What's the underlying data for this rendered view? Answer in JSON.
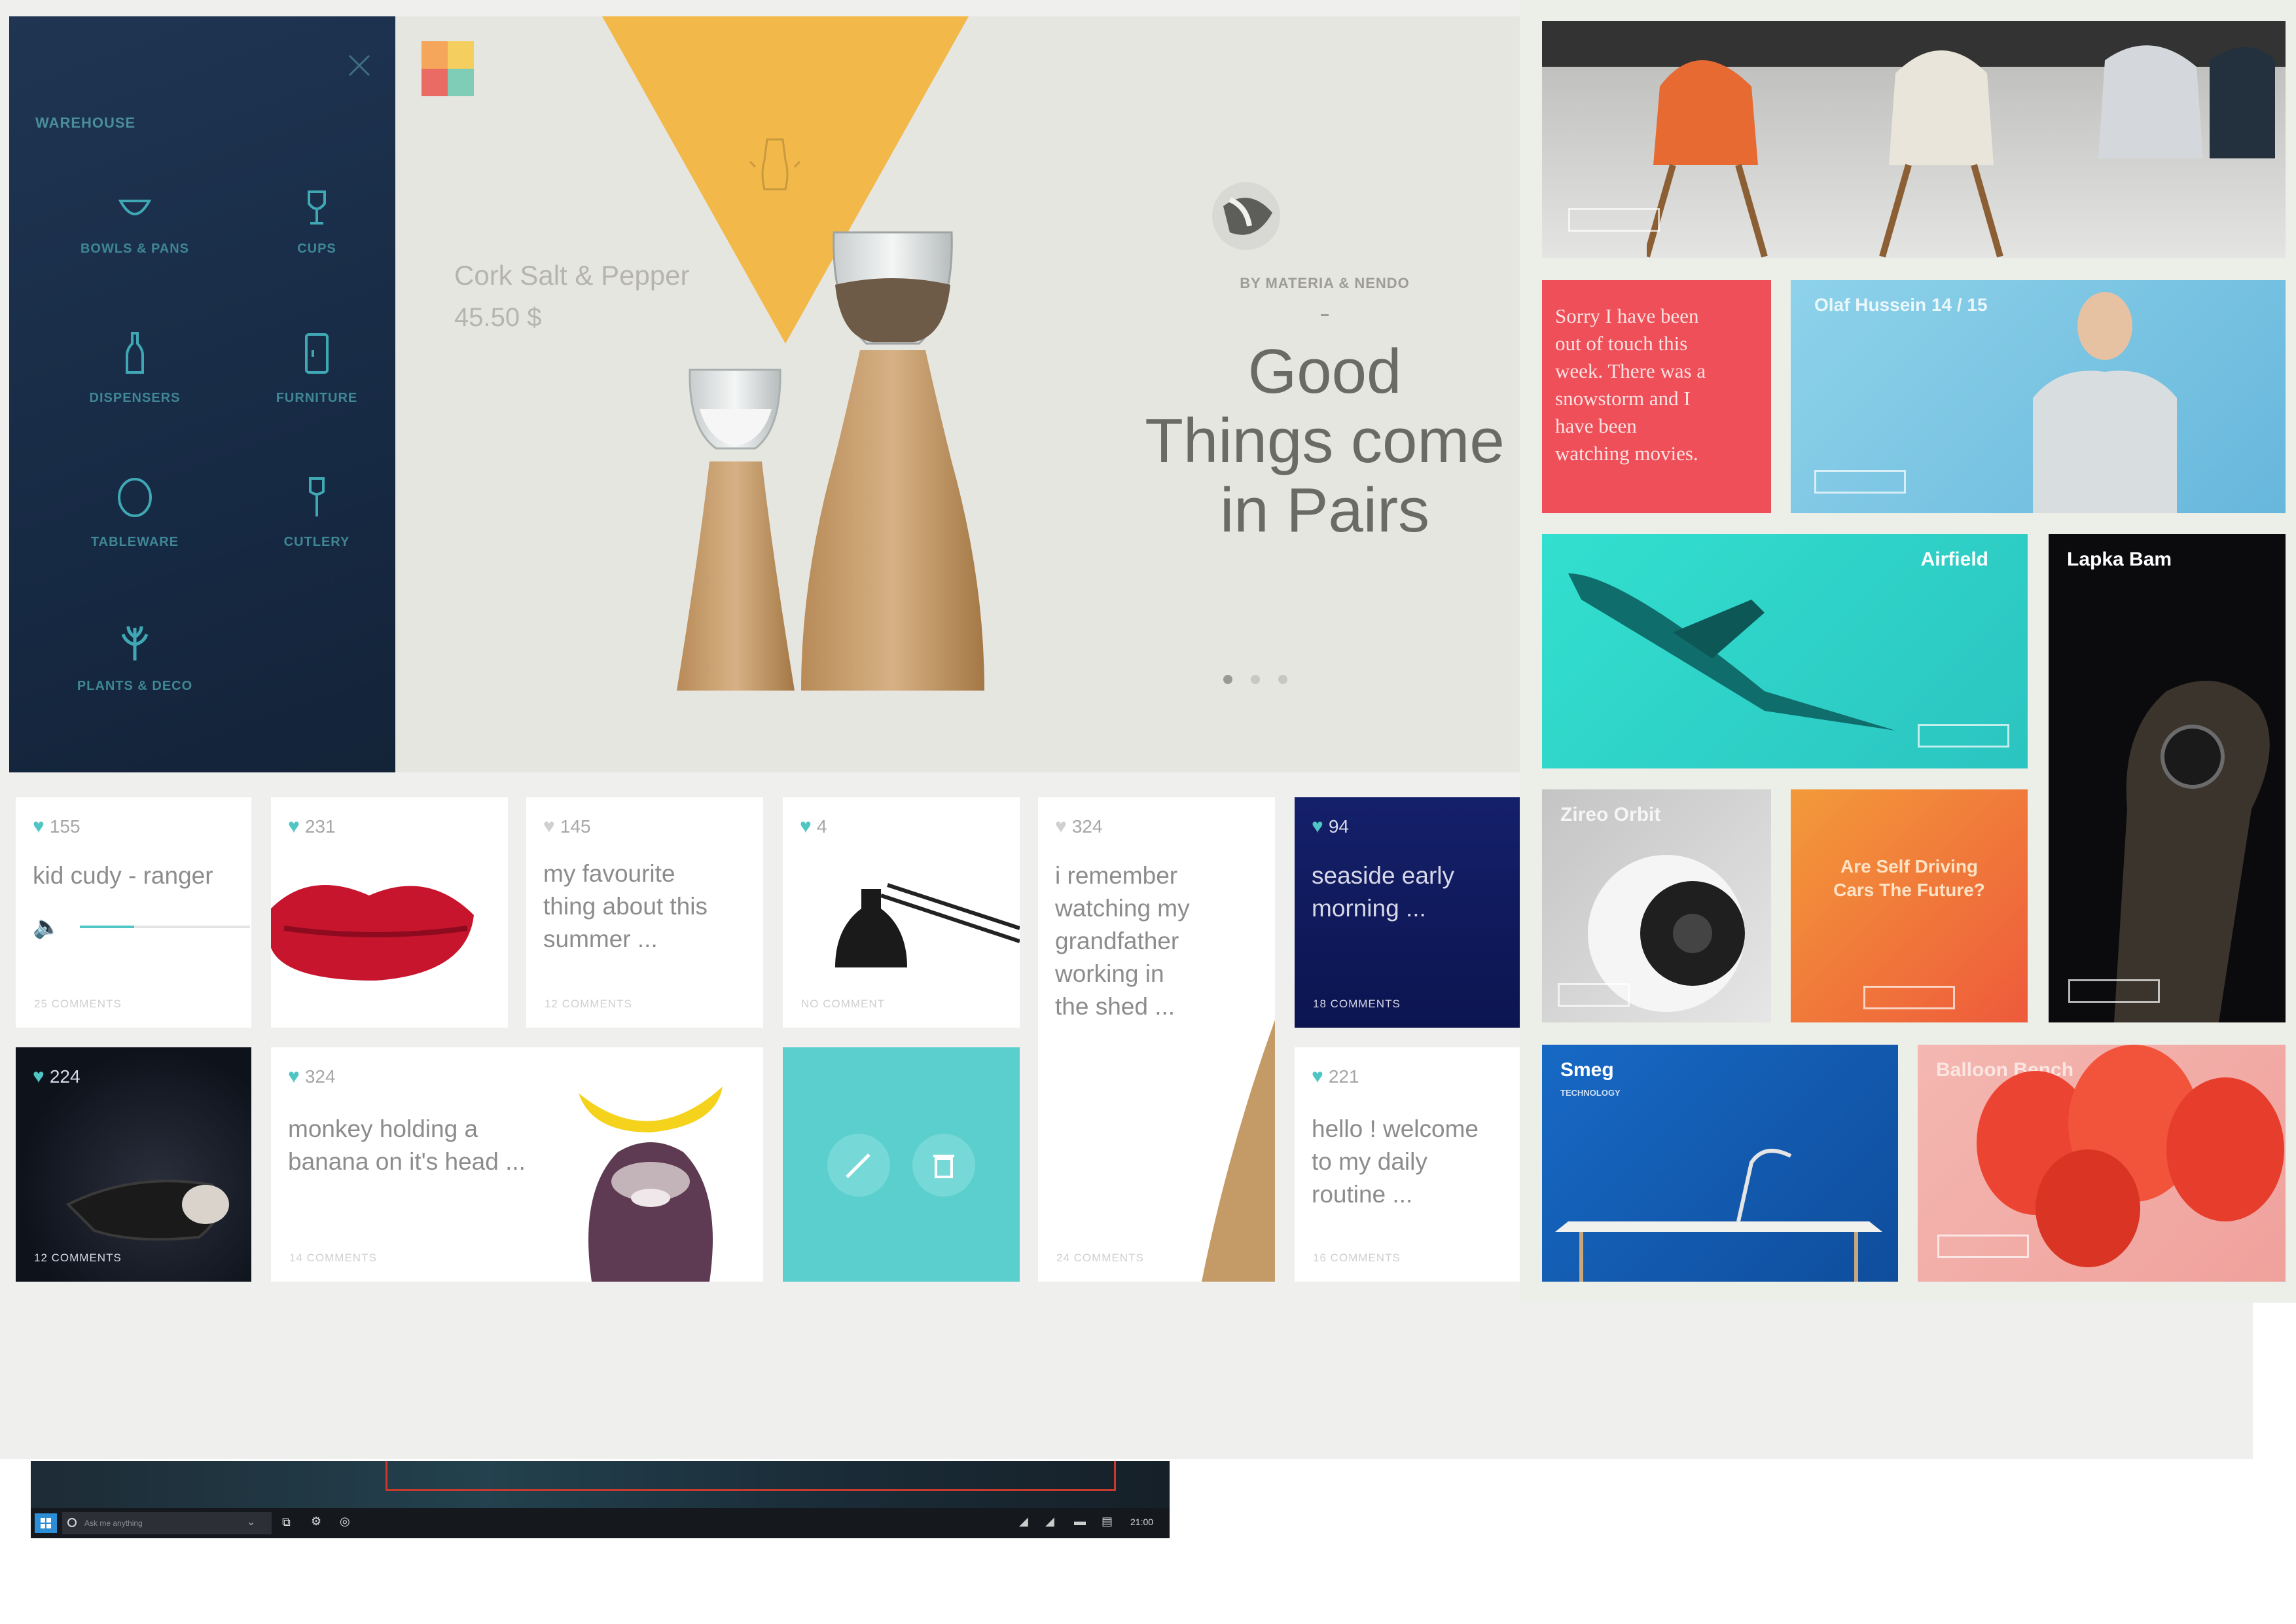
{
  "sidebar": {
    "title": "WAREHOUSE",
    "categories": [
      {
        "label": "BOWLS & PANS",
        "icon": "bowl-icon"
      },
      {
        "label": "CUPS",
        "icon": "cup-icon"
      },
      {
        "label": "DISPENSERS",
        "icon": "bottle-icon"
      },
      {
        "label": "FURNITURE",
        "icon": "cabinet-icon"
      },
      {
        "label": "TABLEWARE",
        "icon": "plate-icon"
      },
      {
        "label": "CUTLERY",
        "icon": "cutlery-icon"
      },
      {
        "label": "PLANTS & DECO",
        "icon": "plant-icon"
      }
    ]
  },
  "hero": {
    "product_name": "Cork Salt & Pepper",
    "price": "45.50 $",
    "byline": "BY MATERIA & NENDO",
    "headline_lines": [
      "Good",
      "Things come",
      "in Pairs"
    ],
    "pages": 3,
    "active_page": 1
  },
  "cards": [
    {
      "likes": "155",
      "text": "kid cudy - ranger",
      "comments": "25 COMMENTS"
    },
    {
      "likes": "231",
      "text": "",
      "comments": ""
    },
    {
      "likes": "145",
      "text_lines": [
        "my favourite",
        "thing about this",
        "summer ..."
      ],
      "comments": "12 COMMENTS"
    },
    {
      "likes": "4",
      "text": "",
      "comments": "NO COMMENT"
    },
    {
      "likes": "324",
      "text_lines": [
        "i remember",
        "watching my",
        "grandfather",
        "working in",
        "the shed ..."
      ],
      "comments": ""
    },
    {
      "likes": "94",
      "text_lines": [
        "seaside early",
        "morning ..."
      ],
      "comments": "18 COMMENTS"
    },
    {
      "likes": "224",
      "text": "",
      "comments": "12 COMMENTS"
    },
    {
      "likes": "324",
      "text_lines": [
        "monkey holding a",
        "banana on it's head ..."
      ],
      "comments": "14 COMMENTS"
    },
    {
      "likes": "221",
      "text_lines": [
        "hello ! welcome",
        "to my daily",
        "routine ..."
      ],
      "comments": "16 COMMENTS"
    },
    {
      "comments": "24 COMMENTS"
    }
  ],
  "tiles": {
    "quote": [
      "Sorry I have been",
      "out of touch this",
      "week. There was a",
      "snowstorm and I",
      "have been",
      "watching movies."
    ],
    "olaf": "Olaf Hussein 14 / 15",
    "airfield": "Airfield",
    "lapka": "Lapka Bam",
    "zireo": "Zireo Orbit",
    "selfdriving": [
      "Are Self Driving",
      "Cars The Future?"
    ],
    "smeg": "Smeg",
    "smeg_sub": "TECHNOLOGY",
    "balloon": "Balloon Bench"
  },
  "taskbar": {
    "search_placeholder": "Ask me anything",
    "clock": "21:00"
  },
  "colors": {
    "accent": "#4fc6c4",
    "sidebar": "#1f3552",
    "hero_triangle": "#f3b84a"
  }
}
